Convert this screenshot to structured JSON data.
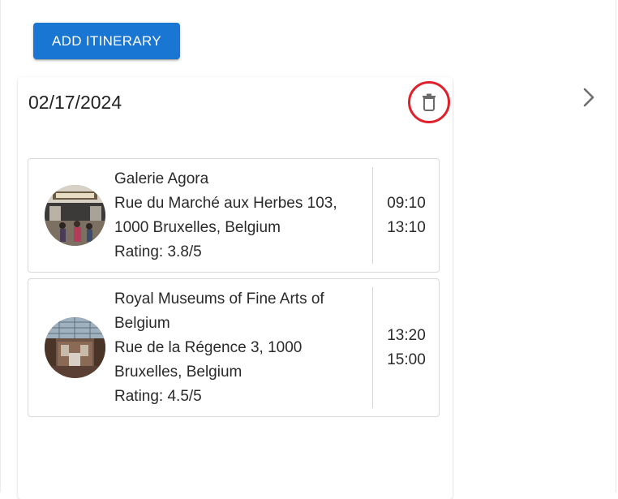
{
  "toolbar": {
    "add_label": "ADD ITINERARY"
  },
  "itinerary": {
    "date": "02/17/2024",
    "stops": [
      {
        "name": "Galerie Agora",
        "address_line1": "Rue du Marché aux Herbes 103,",
        "address_line2": "1000 Bruxelles, Belgium",
        "rating": "Rating: 3.8/5",
        "start": "09:10",
        "end": "13:10"
      },
      {
        "name_line1": "Royal Museums of Fine Arts of",
        "name_line2": "Belgium",
        "address_line1": "Rue de la Régence 3, 1000",
        "address_line2": "Bruxelles, Belgium",
        "rating": "Rating: 4.5/5",
        "start": "13:20",
        "end": "15:00"
      }
    ]
  },
  "icons": {
    "delete": "trash-icon",
    "next": "chevron-right-icon"
  },
  "colors": {
    "primary": "#1976d2",
    "highlight_ring": "#e0202a"
  }
}
